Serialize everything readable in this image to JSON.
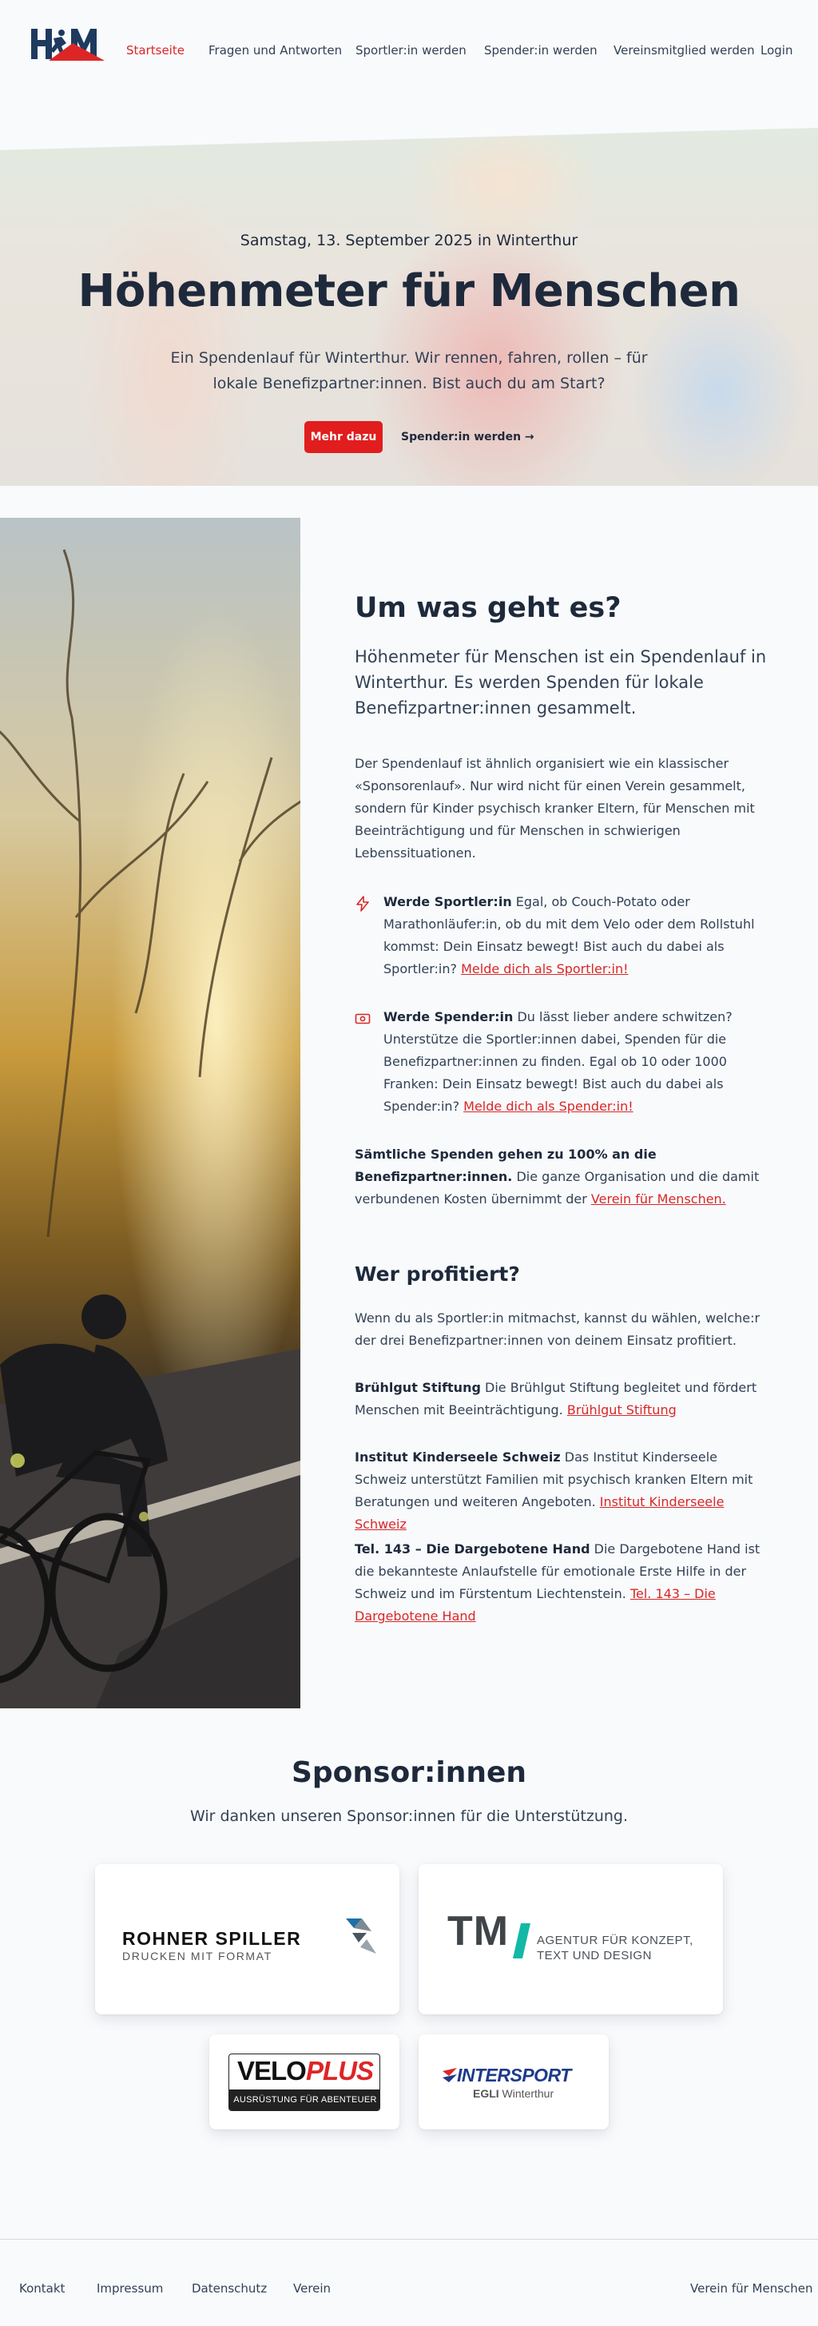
{
  "brand": {
    "logo_text": "HfM",
    "accent": "#dc2626",
    "navy": "#1e293b"
  },
  "nav": {
    "items": [
      "Startseite",
      "Fragen und Antworten",
      "Sportler:in werden",
      "Spender:in werden",
      "Vereinsmitglied werden"
    ],
    "login": "Login"
  },
  "hero": {
    "date": "Samstag, 13. September 2025 in Winterthur",
    "title": "Höhenmeter für Menschen",
    "text": "Ein Spendenlauf für Winterthur. Wir rennen, fahren, rollen – für lokale Benefizpartner:innen. Bist auch du am Start?",
    "cta_primary": "Mehr dazu",
    "cta_secondary": "Spender:in werden →"
  },
  "about": {
    "title": "Um was geht es?",
    "lead": "Höhenmeter für Menschen ist ein Spendenlauf in Winterthur. Es werden Spenden für lokale Benefizpartner:innen gesammelt.",
    "intro": "Der Spendenlauf ist ähnlich organisiert wie ein klassischer «Sponsorenlauf». Nur wird nicht für einen Verein gesammelt, sondern für Kinder psychisch kranker Eltern, für Menschen mit Beeinträchtigung und für Menschen in schwierigen Lebenssituationen.",
    "features": [
      {
        "icon": "bolt-icon",
        "title": "Werde Sportler:in",
        "text": " Egal, ob Couch-Potato oder Marathonläufer:in, ob du mit dem Velo oder dem Rollstuhl kommst: Dein Einsatz bewegt! Bist auch du dabei als Sportler:in? ",
        "link": "Melde dich als Sportler:in!"
      },
      {
        "icon": "banknote-icon",
        "title": "Werde Spender:in",
        "text": " Du lässt lieber andere schwitzen? Unterstütze die Sportler:innen dabei, Spenden für die Benefizpartner:innen zu finden. Egal ob 10 oder 1000 Franken: Dein Einsatz bewegt! Bist auch du dabei als Spender:in? ",
        "link": "Melde dich als Spender:in!"
      }
    ],
    "note_bold": "Sämtliche Spenden gehen zu 100% an die Benefizpartner:innen.",
    "note_text": " Die ganze Organisation und die damit verbundenen Kosten übernimmt der ",
    "note_link": "Verein für Menschen."
  },
  "beneficiaries": {
    "title": "Wer profitiert?",
    "intro": "Wenn du als Sportler:in mitmachst, kannst du wählen, welche:r der drei Benefizpartner:innen von deinem Einsatz profitiert.",
    "items": [
      {
        "name": "Brühlgut Stiftung",
        "text": " Die Brühlgut Stiftung begleitet und fördert Menschen mit Beeinträchtigung. ",
        "link": "Brühlgut Stiftung"
      },
      {
        "name": "Institut Kinderseele Schweiz",
        "text": " Das Institut Kinderseele Schweiz unterstützt Familien mit psychisch kranken Eltern mit Beratungen und weiteren Angeboten. ",
        "link": "Institut Kinderseele Schweiz"
      },
      {
        "name": "Tel. 143 – Die Dargebotene Hand",
        "text": " Die Dargebotene Hand ist die bekannteste Anlaufstelle für emotionale Erste Hilfe in der Schweiz und im Fürstentum Liechtenstein. ",
        "link": "Tel. 143 – Die Dargebotene Hand"
      }
    ]
  },
  "sponsors": {
    "title": "Sponsor:innen",
    "subtitle": "Wir danken unseren Sponsor:innen für die Unterstützung.",
    "logos": {
      "rohner_name": "ROHNER SPILLER",
      "rohner_tag": "DRUCKEN MIT FORMAT",
      "tm_mark": "TM",
      "tm_line1": "AGENTUR FÜR KONZEPT,",
      "tm_line2": "TEXT UND DESIGN",
      "velo_a": "VELO",
      "velo_b": "PLUS",
      "velo_tag": "AUSRÜSTUNG FÜR ABENTEUER",
      "inter_name": "INTERSPORT",
      "inter_sub_bold": "EGLI",
      "inter_sub": " Winterthur"
    }
  },
  "footer": {
    "links": [
      "Kontakt",
      "Impressum",
      "Datenschutz",
      "Verein"
    ],
    "right": "Verein für Menschen"
  }
}
